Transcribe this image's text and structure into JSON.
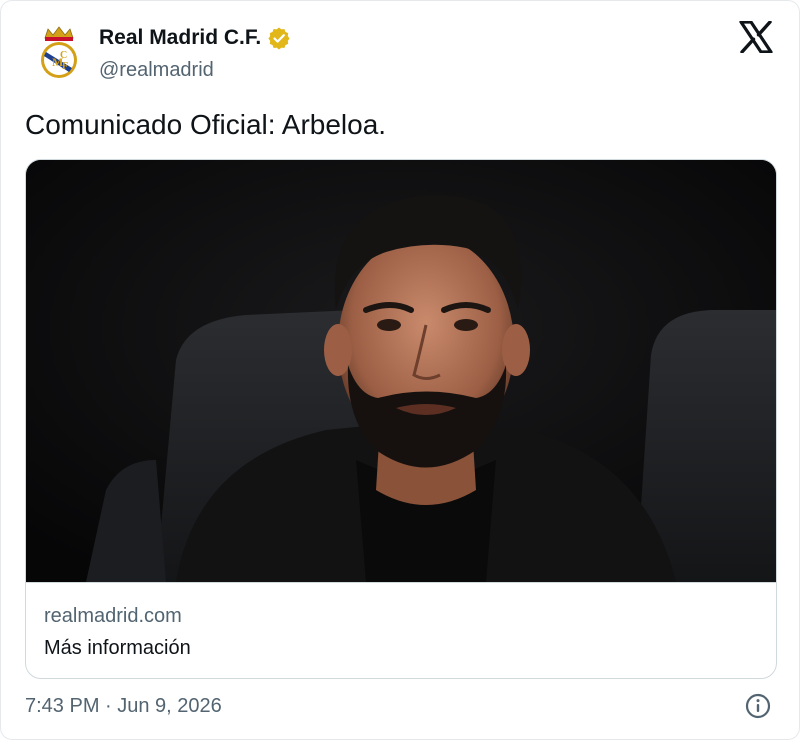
{
  "author": {
    "display_name": "Real Madrid C.F.",
    "handle": "@realmadrid",
    "avatar_icon": "real-madrid-crest-icon",
    "verified_icon": "verified-badge-icon",
    "verified_color": "#e2b719"
  },
  "platform_icon": "x-logo-icon",
  "tweet": {
    "text": "Comunicado Oficial: Arbeloa."
  },
  "card": {
    "image": "photo-of-man-with-dark-hair-and-beard",
    "domain": "realmadrid.com",
    "title": "Más información"
  },
  "meta": {
    "timestamp": "7:43 PM · Jun 9, 2026",
    "info_icon": "info-icon"
  },
  "colors": {
    "text_primary": "#0f1419",
    "text_secondary": "#536471",
    "border": "#cfd9de"
  }
}
